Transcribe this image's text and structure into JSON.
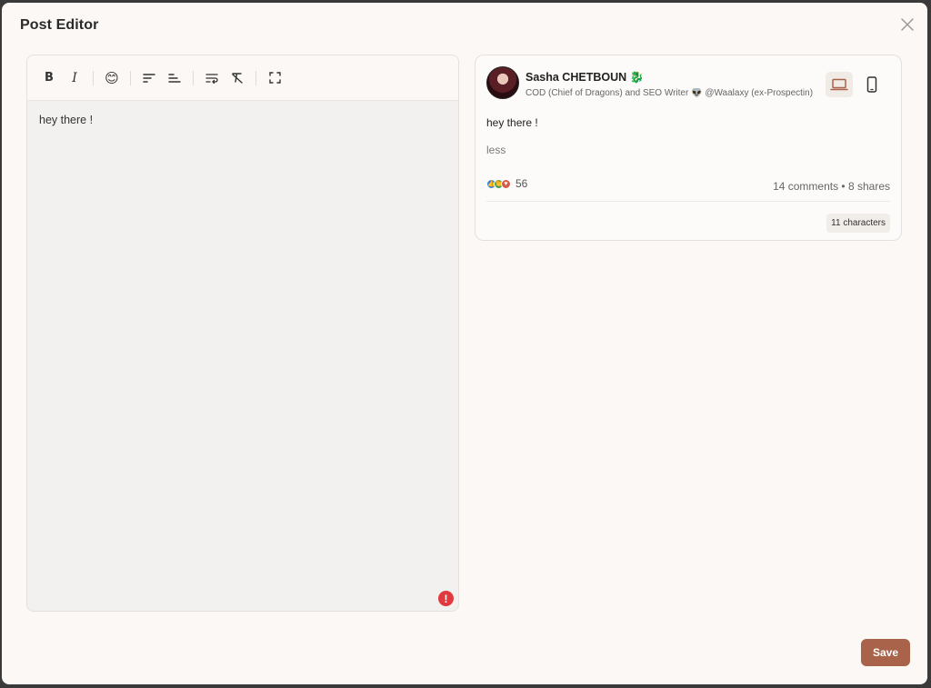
{
  "modal": {
    "title": "Post Editor",
    "close_icon": "close-icon"
  },
  "toolbar": {
    "bold": "B",
    "italic": "I",
    "emoji": "😊",
    "icons": [
      "bold-icon",
      "italic-icon",
      "emoji-icon",
      "align-left-icon",
      "align-short-icon",
      "text-wrap-icon",
      "clear-format-icon",
      "fullscreen-icon"
    ]
  },
  "editor": {
    "content": "hey there !",
    "error_symbol": "!"
  },
  "preview": {
    "author_name": "Sasha CHETBOUN 🐉",
    "author_headline": "COD (Chief of Dragons) and SEO Writer 👽 @Waalaxy (ex-Prospectin)",
    "post_text": "hey there !",
    "less_label": "less",
    "reaction_count": "56",
    "stats": "14 comments • 8 shares",
    "char_count": "11 characters"
  },
  "footer": {
    "save_label": "Save"
  },
  "colors": {
    "accent": "#a8634a",
    "error": "#e0393e",
    "background": "#fbf8f5"
  }
}
